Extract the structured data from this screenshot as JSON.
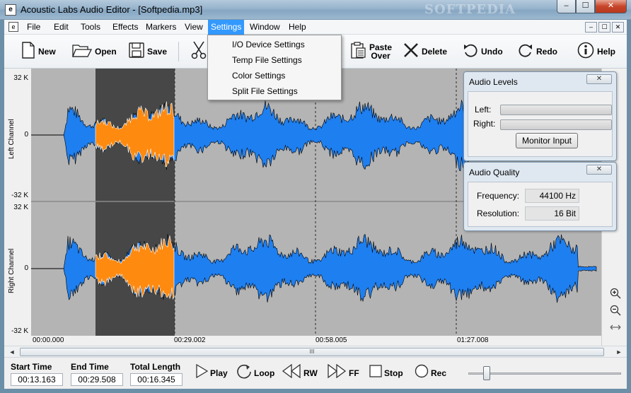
{
  "window": {
    "title": "Acoustic Labs Audio Editor - [Softpedia.mp3]",
    "watermark": "SOFTPEDIA",
    "min_glyph": "–",
    "max_glyph": "☐",
    "close_glyph": "✕",
    "app_icon_glyph": "e"
  },
  "menubar": {
    "items": [
      "File",
      "Edit",
      "Tools",
      "Effects",
      "Markers",
      "View",
      "Settings",
      "Window",
      "Help"
    ],
    "active": "Settings"
  },
  "toolbar": {
    "new": "New",
    "open": "Open",
    "save": "Save",
    "paste_over_1": "Paste",
    "paste_over_2": "Over",
    "delete": "Delete",
    "undo": "Undo",
    "redo": "Redo",
    "help": "Help"
  },
  "settings_menu": {
    "items": [
      "I/O Device Settings",
      "Temp File Settings",
      "Color Settings",
      "Split File Settings"
    ]
  },
  "waveform": {
    "left_channel": "Left Channel",
    "right_channel": "Right Channel",
    "y_top": "32 K",
    "y_mid": "0",
    "y_bottom": "-32 K",
    "time_labels": [
      "00:00.000",
      "00:29.002",
      "00:58.005",
      "01:27.008"
    ],
    "colors": {
      "wave": "#1e7ff0",
      "selection_wave": "#ff8a10",
      "selection_bg": "#474747",
      "background": "#b4b4b4"
    }
  },
  "scrollbar": {
    "grip": "III",
    "left_arrow": "◄",
    "right_arrow": "►"
  },
  "transport": {
    "start_time_label": "Start Time",
    "start_time": "00:13.163",
    "end_time_label": "End Time",
    "end_time": "00:29.508",
    "total_length_label": "Total Length",
    "total_length": "00:16.345",
    "play": "Play",
    "loop": "Loop",
    "rw": "RW",
    "ff": "FF",
    "stop": "Stop",
    "rec": "Rec"
  },
  "audio_levels": {
    "title": "Audio Levels",
    "left": "Left:",
    "right": "Right:",
    "monitor_input": "Monitor Input"
  },
  "audio_quality": {
    "title": "Audio Quality",
    "frequency_label": "Frequency:",
    "frequency": "44100 Hz",
    "resolution_label": "Resolution:",
    "resolution": "16 Bit"
  }
}
